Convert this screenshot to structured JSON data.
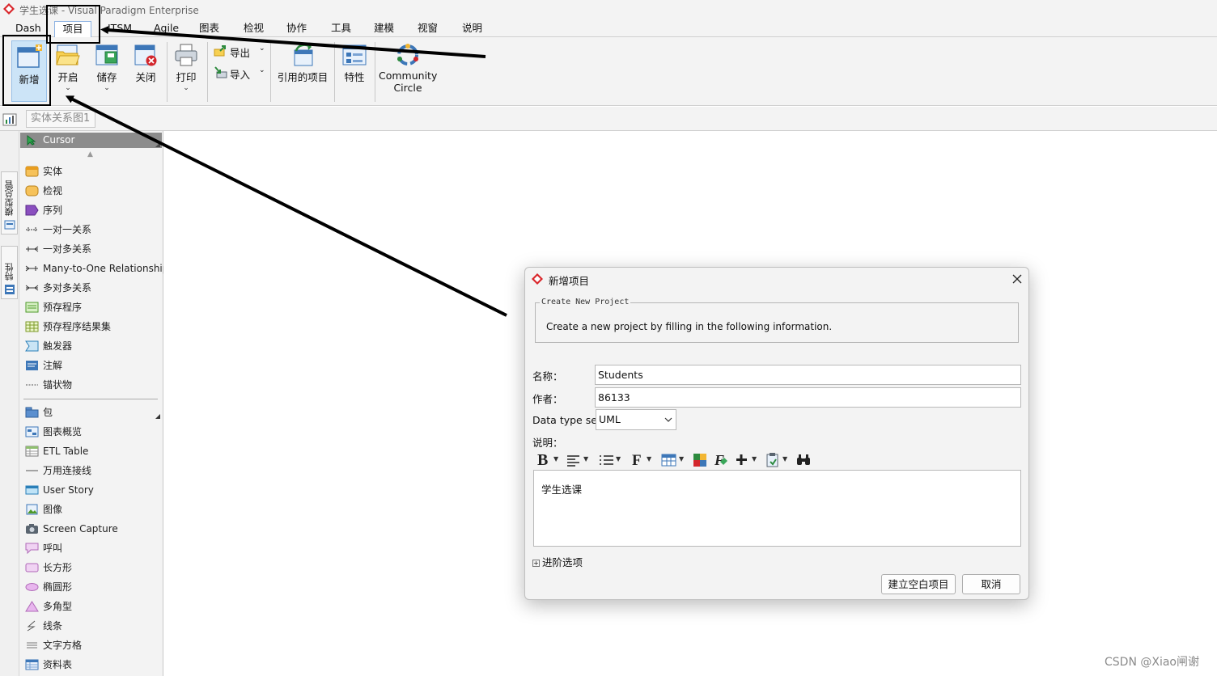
{
  "window": {
    "title": "学生选课 - Visual Paradigm Enterprise",
    "logo_icon": "vp-logo-icon"
  },
  "menu": {
    "tabs": [
      "Dash",
      "项目",
      "ITSM",
      "Agile",
      "图表",
      "检视",
      "协作",
      "工具",
      "建模",
      "视窗",
      "说明"
    ],
    "active": "项目"
  },
  "ribbon": {
    "new": "新增",
    "open": "开启",
    "save": "储存",
    "close": "关闭",
    "print": "打印",
    "export": "导出",
    "import": "导入",
    "referenced": "引用的项目",
    "properties": "特性",
    "community_line1": "Community",
    "community_line2": "Circle"
  },
  "diagram_tab": "实体关系图1",
  "side_tabs": {
    "model_explorer": "模型总管",
    "properties": "特性"
  },
  "palette": {
    "cursor": "Cursor",
    "items": [
      {
        "label": "实体",
        "icon": "entity-icon"
      },
      {
        "label": "检视",
        "icon": "view-icon"
      },
      {
        "label": "序列",
        "icon": "sequence-icon"
      },
      {
        "label": "一对一关系",
        "icon": "one-to-one-icon"
      },
      {
        "label": "一对多关系",
        "icon": "one-to-many-icon"
      },
      {
        "label": "Many-to-One Relationship",
        "icon": "many-to-one-icon"
      },
      {
        "label": "多对多关系",
        "icon": "many-to-many-icon"
      },
      {
        "label": "预存程序",
        "icon": "stored-procedure-icon"
      },
      {
        "label": "预存程序结果集",
        "icon": "result-set-icon"
      },
      {
        "label": "触发器",
        "icon": "trigger-icon"
      },
      {
        "label": "注解",
        "icon": "comment-icon"
      },
      {
        "label": "锚状物",
        "icon": "anchor-icon"
      }
    ],
    "items2": [
      {
        "label": "包",
        "icon": "package-icon"
      },
      {
        "label": "图表概览",
        "icon": "diagram-overview-icon"
      },
      {
        "label": "ETL Table",
        "icon": "etl-table-icon"
      },
      {
        "label": "万用连接线",
        "icon": "freehand-connector-icon"
      },
      {
        "label": "User Story",
        "icon": "user-story-icon"
      },
      {
        "label": "图像",
        "icon": "image-icon"
      },
      {
        "label": "Screen Capture",
        "icon": "camera-icon"
      },
      {
        "label": "呼叫",
        "icon": "callout-icon"
      },
      {
        "label": "长方形",
        "icon": "rectangle-icon"
      },
      {
        "label": "椭圆形",
        "icon": "ellipse-icon"
      },
      {
        "label": "多角型",
        "icon": "polygon-icon"
      },
      {
        "label": "线条",
        "icon": "line-icon"
      },
      {
        "label": "文字方格",
        "icon": "text-box-icon"
      },
      {
        "label": "资料表",
        "icon": "data-table-icon"
      }
    ]
  },
  "dialog": {
    "title": "新增项目",
    "group_title": "Create New Project",
    "group_text": "Create a new project by filling in the following information.",
    "name_label": "名称：",
    "name_value": "Students",
    "author_label": "作者：",
    "author_value": "86133",
    "datatype_label": "Data type set:",
    "datatype_value": "UML",
    "desc_label": "说明：",
    "desc_value": "学生选课",
    "advanced": "进阶选项",
    "create_button": "建立空白项目",
    "cancel_button": "取消"
  },
  "watermark": "CSDN @Xiao闸谢"
}
